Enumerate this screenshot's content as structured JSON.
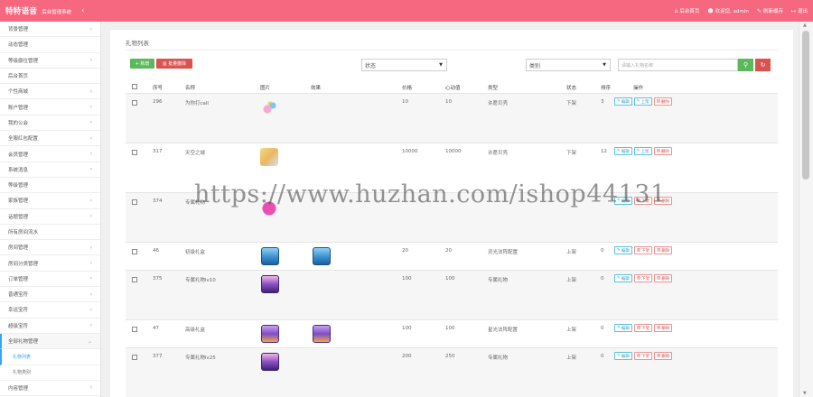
{
  "header": {
    "brand": "特特语音",
    "subtitle": "后台管理系统",
    "toggle_icon": "chevron-left-icon",
    "links": [
      {
        "icon": "home-icon",
        "label": "后台首页"
      },
      {
        "icon": "users-icon",
        "label": "欢迎您, admin"
      },
      {
        "icon": "refresh-icon",
        "label": "刷新缓存"
      },
      {
        "icon": "logout-icon",
        "label": "退出"
      }
    ],
    "colors": {
      "bar": "#f5687f"
    }
  },
  "sidebar": {
    "items": [
      {
        "label": "背景管理",
        "has_children": true
      },
      {
        "label": "动态管理",
        "has_children": false
      },
      {
        "label": "等级爵位管理",
        "has_children": true
      },
      {
        "label": "后台首页",
        "has_children": false
      },
      {
        "label": "个性商城",
        "has_children": true
      },
      {
        "label": "账户管理",
        "has_children": true
      },
      {
        "label": "我的公会",
        "has_children": true
      },
      {
        "label": "全服红包配置",
        "has_children": true
      },
      {
        "label": "会员管理",
        "has_children": true
      },
      {
        "label": "系统消息",
        "has_children": true
      },
      {
        "label": "等级管理",
        "has_children": false
      },
      {
        "label": "家族管理",
        "has_children": true
      },
      {
        "label": "话题管理",
        "has_children": true
      },
      {
        "label": "所有房间流水",
        "has_children": false
      },
      {
        "label": "房间管理",
        "has_children": true
      },
      {
        "label": "房间分类管理",
        "has_children": true
      },
      {
        "label": "订单管理",
        "has_children": true
      },
      {
        "label": "普通宝符",
        "has_children": true
      },
      {
        "label": "幸运宝符",
        "has_children": true
      },
      {
        "label": "超级宝符",
        "has_children": true
      },
      {
        "label": "全部礼物管理",
        "has_children": true,
        "active": true
      }
    ],
    "subitems": [
      {
        "label": "礼物列表",
        "current": true
      },
      {
        "label": "礼物类别",
        "current": false
      }
    ],
    "last_item": {
      "label": "内容管理",
      "has_children": true
    }
  },
  "main": {
    "title": "礼物列表",
    "buttons": {
      "new": "新增",
      "batch_delete": "批量删除"
    },
    "filters": {
      "status_label": "状态",
      "category_label": "类别",
      "search_placeholder": "请输入礼物名称"
    },
    "columns": [
      "序号",
      "名称",
      "图片",
      "效果",
      "价格",
      "心动值",
      "类型",
      "状态",
      "排序",
      "操作"
    ],
    "rows": [
      {
        "id": "296",
        "name": "为你打call",
        "img": "gift-ballon",
        "effect": "",
        "price": "10",
        "heart": "10",
        "type": "许愿贝壳",
        "status": "下架",
        "sort": "3",
        "ops": [
          "编辑",
          "上架",
          "删除"
        ]
      },
      {
        "id": "317",
        "name": "天空之城",
        "img": "gift-palace",
        "effect": "",
        "price": "10000",
        "heart": "10000",
        "type": "许愿贝壳",
        "status": "下架",
        "sort": "12",
        "ops": [
          "编辑",
          "上架",
          "删除"
        ]
      },
      {
        "id": "374",
        "name": "专属礼物",
        "img": "gift-potion",
        "effect": "",
        "price": "",
        "heart": "",
        "type": "",
        "status": "",
        "sort": "",
        "ops": [
          "编辑",
          "下架",
          "删除"
        ]
      },
      {
        "id": "46",
        "name": "初级礼盒",
        "img": "gift-chest",
        "effect": "gift-chest",
        "price": "20",
        "heart": "20",
        "type": "灵光法阵配置",
        "status": "上架",
        "sort": "0",
        "ops": [
          "编辑",
          "下架",
          "删除"
        ]
      },
      {
        "id": "375",
        "name": "专属礼物lv10",
        "img": "gift-exclusive",
        "effect": "",
        "price": "100",
        "heart": "100",
        "type": "专属礼物",
        "status": "上架",
        "sort": "0",
        "ops": [
          "编辑",
          "下架",
          "删除"
        ]
      },
      {
        "id": "47",
        "name": "高级礼盒",
        "img": "gift-purple",
        "effect": "gift-purple",
        "price": "100",
        "heart": "100",
        "type": "星光法阵配置",
        "status": "上架",
        "sort": "0",
        "ops": [
          "编辑",
          "下架",
          "删除"
        ]
      },
      {
        "id": "377",
        "name": "专属礼物lv25",
        "img": "gift-exclusive",
        "effect": "",
        "price": "200",
        "heart": "250",
        "type": "专属礼物",
        "status": "上架",
        "sort": "0",
        "ops": [
          "编辑",
          "下架",
          "删除"
        ]
      }
    ]
  },
  "watermark": "https://www.huzhan.com/ishop44131",
  "scrollbar": {
    "up_icon": "triangle-up-icon",
    "down_icon": "triangle-down-icon"
  }
}
